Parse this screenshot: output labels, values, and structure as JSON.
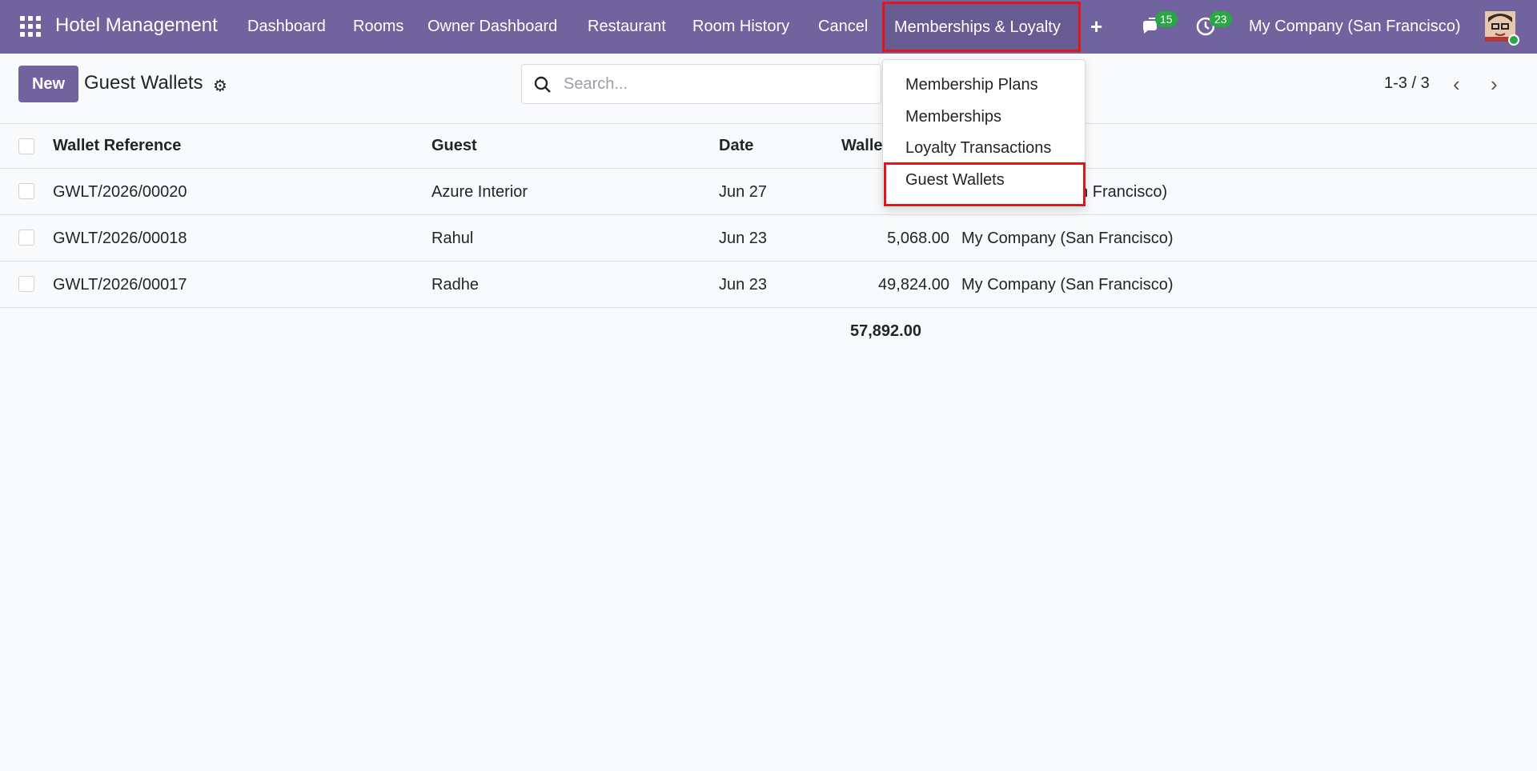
{
  "navbar": {
    "brand": "Hotel Management",
    "menu": [
      "Dashboard",
      "Rooms",
      "Owner Dashboard",
      "Restaurant",
      "Room History",
      "Cancel",
      "Memberships & Loyalty"
    ],
    "messages_count": "15",
    "activities_count": "23",
    "company": "My Company (San Francisco)",
    "plus_icon": "plus-icon",
    "chat_icon": "chat-icon",
    "clock_icon": "clock-icon"
  },
  "control": {
    "new_label": "New",
    "title": "Guest Wallets",
    "search_placeholder": "Search...",
    "pager": "1-3 / 3"
  },
  "table": {
    "columns": [
      "Wallet Reference",
      "Guest",
      "Date",
      "Walle"
    ],
    "rows": [
      {
        "ref": "GWLT/2026/00020",
        "guest": "Azure Interior",
        "date": "Jun 27",
        "balance": "",
        "company": "an Francisco)"
      },
      {
        "ref": "GWLT/2026/00018",
        "guest": "Rahul",
        "date": "Jun 23",
        "balance": "5,068.00",
        "company": "My Company (San Francisco)"
      },
      {
        "ref": "GWLT/2026/00017",
        "guest": "Radhe",
        "date": "Jun 23",
        "balance": "49,824.00",
        "company": "My Company (San Francisco)"
      }
    ],
    "total": "57,892.00"
  },
  "dropdown": {
    "items": [
      "Membership Plans",
      "Memberships",
      "Loyalty Transactions",
      "Guest Wallets"
    ]
  },
  "colors": {
    "brand": "#71639e",
    "badge": "#28a745",
    "highlight": "#e0161c"
  }
}
